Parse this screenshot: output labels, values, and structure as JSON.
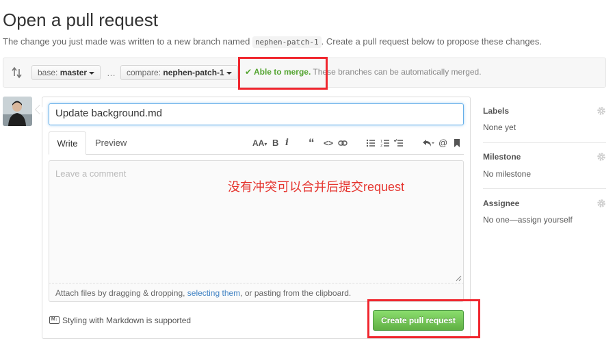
{
  "page": {
    "title": "Open a pull request",
    "subtitle_before": "The change you just made was written to a new branch named ",
    "branch_name": "nephen-patch-1",
    "subtitle_after": ". Create a pull request below to propose these changes."
  },
  "compare": {
    "base_label": "base: ",
    "base_branch": "master",
    "ellipsis": "…",
    "compare_label": "compare: ",
    "compare_branch": "nephen-patch-1",
    "merge_ok": "Able to merge.",
    "merge_text": " These branches can be automatically merged."
  },
  "form": {
    "title_value": "Update background.md",
    "tab_write": "Write",
    "tab_preview": "Preview",
    "toolbar_icons": [
      "text-size-icon",
      "bold-icon",
      "italic-icon",
      "quote-icon",
      "code-icon",
      "link-icon",
      "bullet-list-icon",
      "numbered-list-icon",
      "task-list-icon",
      "reply-icon",
      "mention-icon",
      "bookmark-icon"
    ],
    "comment_placeholder": "Leave a comment",
    "annotation": "没有冲突可以合并后提交request",
    "attach_before": "Attach files by dragging & dropping, ",
    "attach_link": "selecting them",
    "attach_after": ", or pasting from the clipboard.",
    "markdown_note": "Styling with Markdown is supported",
    "submit_label": "Create pull request"
  },
  "sidebar": {
    "labels_heading": "Labels",
    "labels_value": "None yet",
    "milestone_heading": "Milestone",
    "milestone_value": "No milestone",
    "assignee_heading": "Assignee",
    "assignee_value": "No one—assign yourself"
  },
  "colors": {
    "merge_ok": "#55a532",
    "primary_button": "#60b044",
    "link": "#4183c4",
    "highlight_box": "#f0262e",
    "annotation": "#e5342e"
  }
}
